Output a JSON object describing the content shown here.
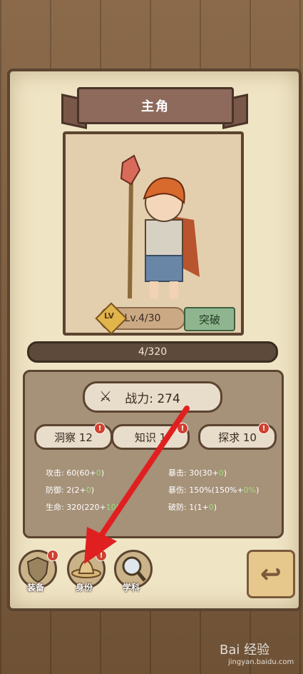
{
  "header": {
    "title": "主角"
  },
  "hero": {
    "level_badge": "LV",
    "level": "Lv.4/30",
    "break_label": "突破",
    "exp": "4/320"
  },
  "power": {
    "label": "战力: 274",
    "sword_icon": "sword-icon"
  },
  "attrs": [
    {
      "label": "洞察 12",
      "alert": "!"
    },
    {
      "label": "知识 1",
      "alert": "!"
    },
    {
      "label": "探求 10",
      "alert": "!"
    }
  ],
  "stats_left": [
    {
      "name": "攻击: 60(60+",
      "bonus": "0",
      "end": ")"
    },
    {
      "name": "防御: 2(2+",
      "bonus": "0",
      "end": ")"
    },
    {
      "name": "生命: 320(220+",
      "bonus": "100",
      "end": ""
    }
  ],
  "stats_right": [
    {
      "name": "暴击: 30(30+",
      "bonus": "0",
      "end": ")"
    },
    {
      "name": "暴伤: 150%(150%+",
      "bonus": "0%",
      "end": ")"
    },
    {
      "name": "破防: 1(1+",
      "bonus": "0",
      "end": ")"
    }
  ],
  "bottom": [
    {
      "label": "装备",
      "icon": "shield-icon",
      "alert": "!"
    },
    {
      "label": "身份",
      "icon": "hat-icon",
      "alert": "!"
    },
    {
      "label": "学科",
      "icon": "magnifier-icon"
    }
  ],
  "watermark": {
    "main": "Bai 经验",
    "sub": "jingyan.baidu.com"
  },
  "colors": {
    "accent": "#d04030",
    "arrow": "#e02020"
  }
}
